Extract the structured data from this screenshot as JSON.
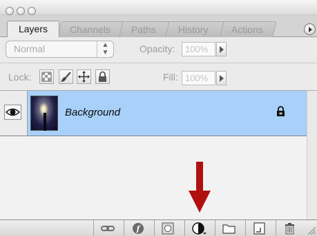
{
  "tabs": [
    {
      "label": "Layers",
      "active": true
    },
    {
      "label": "Channels",
      "active": false
    },
    {
      "label": "Paths",
      "active": false
    },
    {
      "label": "History",
      "active": false
    },
    {
      "label": "Actions",
      "active": false
    }
  ],
  "blend": {
    "mode": "Normal",
    "opacity_label": "Opacity:",
    "opacity_value": "100%"
  },
  "lock_row": {
    "lock_label": "Lock:",
    "fill_label": "Fill:",
    "fill_value": "100%"
  },
  "layers": [
    {
      "name": "Background",
      "visible": true,
      "locked": true,
      "selected": true
    }
  ],
  "colors": {
    "selection": "#a8d0f9",
    "annotation_arrow": "#b01010"
  }
}
